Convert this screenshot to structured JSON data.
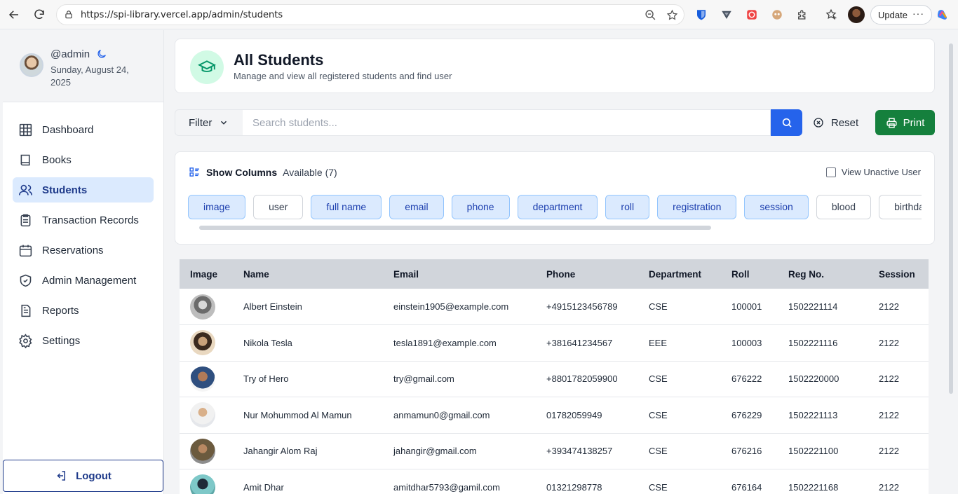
{
  "browser": {
    "url": "https://spi-library.vercel.app/admin/students",
    "update_label": "Update",
    "more_label": "···"
  },
  "profile": {
    "username": "@admin",
    "date": "Sunday, August 24, 2025"
  },
  "sidebar": {
    "items": [
      {
        "label": "Dashboard",
        "icon": "grid-icon"
      },
      {
        "label": "Books",
        "icon": "book-icon"
      },
      {
        "label": "Students",
        "icon": "users-icon",
        "active": true
      },
      {
        "label": "Transaction Records",
        "icon": "clipboard-icon"
      },
      {
        "label": "Reservations",
        "icon": "calendar-icon"
      },
      {
        "label": "Admin Management",
        "icon": "shield-icon"
      },
      {
        "label": "Reports",
        "icon": "file-text-icon"
      },
      {
        "label": "Settings",
        "icon": "gear-icon"
      }
    ],
    "logout_label": "Logout"
  },
  "header": {
    "title": "All Students",
    "subtitle": "Manage and view all registered students and find user"
  },
  "toolbar": {
    "filter_label": "Filter",
    "search_placeholder": "Search students...",
    "reset_label": "Reset",
    "print_label": "Print"
  },
  "columns": {
    "title": "Show Columns",
    "available": "Available (7)",
    "view_unactive_label": "View Unactive User",
    "chips": [
      {
        "label": "image",
        "on": true
      },
      {
        "label": "user",
        "on": false
      },
      {
        "label": "full name",
        "on": true
      },
      {
        "label": "email",
        "on": true
      },
      {
        "label": "phone",
        "on": true
      },
      {
        "label": "department",
        "on": true
      },
      {
        "label": "roll",
        "on": true
      },
      {
        "label": "registration",
        "on": true
      },
      {
        "label": "session",
        "on": true
      },
      {
        "label": "blood",
        "on": false
      },
      {
        "label": "birthday",
        "on": false
      }
    ]
  },
  "table": {
    "headers": [
      "Image",
      "Name",
      "Email",
      "Phone",
      "Department",
      "Roll",
      "Reg No.",
      "Session"
    ],
    "rows": [
      {
        "name": "Albert Einstein",
        "email": "einstein1905@example.com",
        "phone": "+4915123456789",
        "department": "CSE",
        "roll": "100001",
        "reg": "1502221114",
        "session": "2122"
      },
      {
        "name": "Nikola Tesla",
        "email": "tesla1891@example.com",
        "phone": "+381641234567",
        "department": "EEE",
        "roll": "100003",
        "reg": "1502221116",
        "session": "2122"
      },
      {
        "name": "Try of Hero",
        "email": "try@gmail.com",
        "phone": "+8801782059900",
        "department": "CSE",
        "roll": "676222",
        "reg": "1502220000",
        "session": "2122"
      },
      {
        "name": "Nur Mohummod Al Mamun",
        "email": "anmamun0@gmail.com",
        "phone": "01782059949",
        "department": "CSE",
        "roll": "676229",
        "reg": "1502221113",
        "session": "2122"
      },
      {
        "name": "Jahangir Alom Raj",
        "email": "jahangir@gmail.com",
        "phone": "+393474138257",
        "department": "CSE",
        "roll": "676216",
        "reg": "1502221100",
        "session": "2122"
      },
      {
        "name": "Amit Dhar",
        "email": "amitdhar5793@gamil.com",
        "phone": "01321298778",
        "department": "CSE",
        "roll": "676164",
        "reg": "1502221168",
        "session": "2122"
      }
    ]
  },
  "colors": {
    "accent": "#2563eb",
    "active_bg": "#dbeafe",
    "print_green": "#15803d",
    "header_icon_bg": "#d1fae5"
  }
}
